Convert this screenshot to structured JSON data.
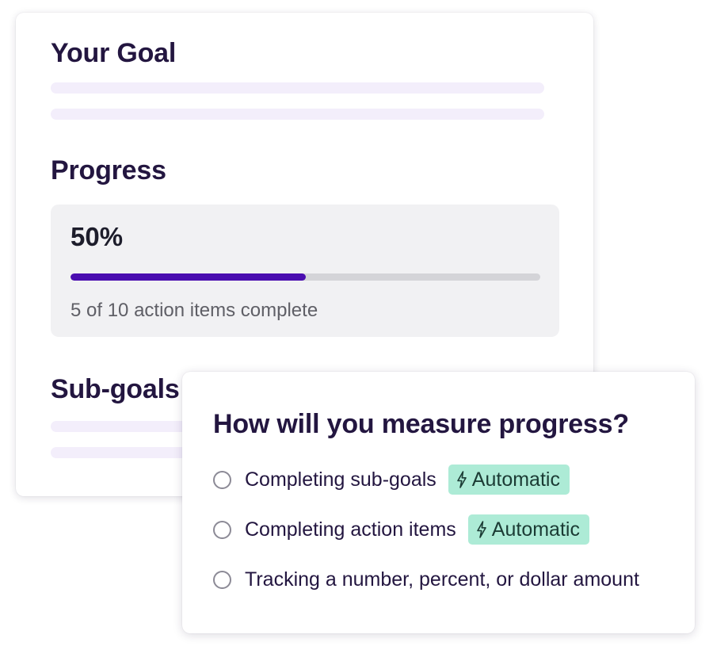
{
  "goal_card": {
    "goal_heading": "Your Goal",
    "progress_heading": "Progress",
    "progress_percent_label": "50%",
    "progress_fraction": 0.5,
    "progress_caption": "5 of 10 action items complete",
    "subgoals_heading": "Sub-goals &"
  },
  "measure_card": {
    "title": "How will you measure progress?",
    "options": [
      {
        "label": "Completing sub-goals",
        "badge": "Automatic",
        "badge_icon": "lightning-bolt-icon"
      },
      {
        "label": "Completing action items",
        "badge": "Automatic",
        "badge_icon": "lightning-bolt-icon"
      },
      {
        "label": "Tracking a number, percent, or dollar amount"
      }
    ]
  },
  "colors": {
    "heading": "#231640",
    "progress_fill": "#4a0db0",
    "progress_track": "#d4d4d8",
    "badge_bg": "#adebd6",
    "skeleton": "#f3eefb"
  }
}
